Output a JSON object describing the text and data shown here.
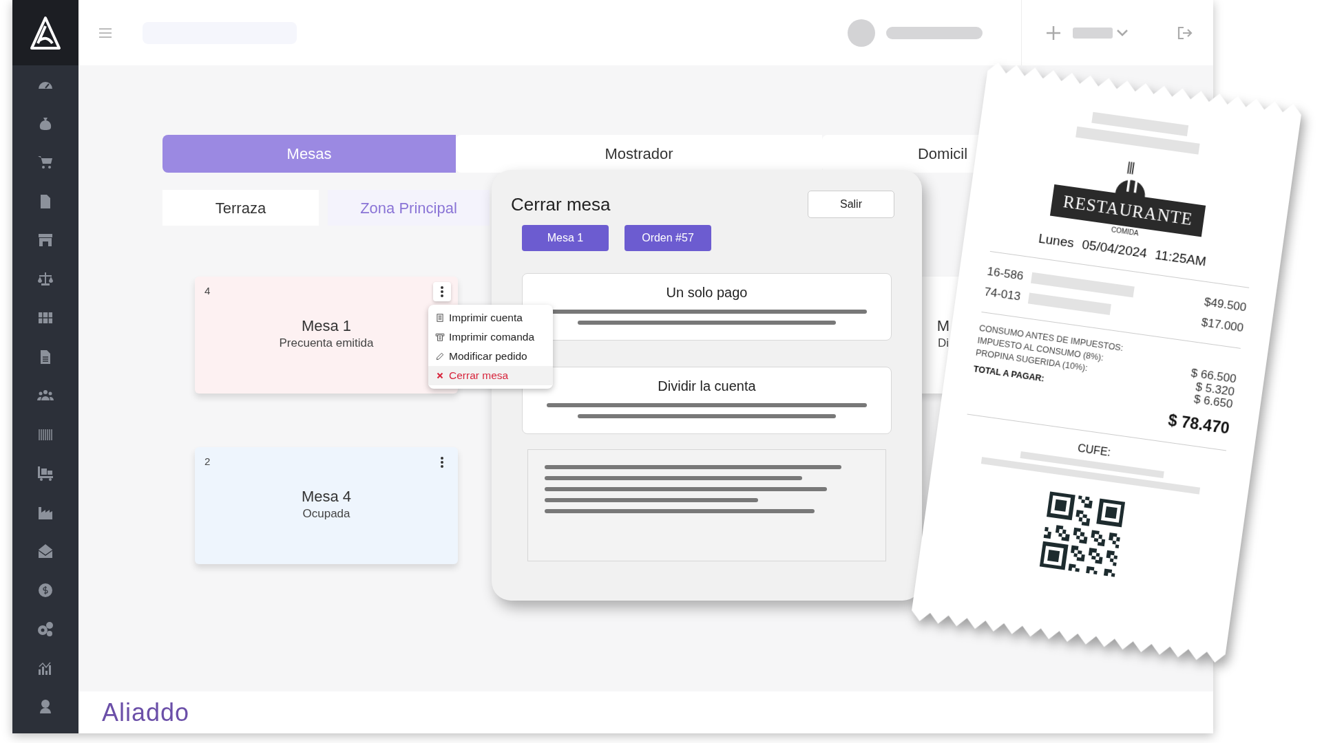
{
  "tabs": [
    {
      "label": "Mesas",
      "selected": true
    },
    {
      "label": "Mostrador",
      "selected": false
    },
    {
      "label": "Domicil",
      "selected": false
    }
  ],
  "zones": [
    {
      "label": "Terraza",
      "selected": false
    },
    {
      "label": "Zona Principal",
      "selected": true
    }
  ],
  "table_rows": [
    [
      {
        "number": "4",
        "name": "Mesa 1",
        "status": "Precuenta emitida",
        "color": "#fdf1f2",
        "menu_open": true
      },
      {
        "name": "M",
        "status": "Di",
        "color": "#ffffff"
      }
    ],
    [
      {
        "number": "2",
        "name": "Mesa 4",
        "status": "Ocupada",
        "color": "#eef5fd",
        "menu_open": false
      }
    ]
  ],
  "table_menu": [
    {
      "kind": "bill",
      "label": "Imprimir cuenta",
      "selected": false
    },
    {
      "kind": "order",
      "label": "Imprimir comanda",
      "selected": false
    },
    {
      "kind": "edit",
      "label": "Modificar pedido",
      "selected": false
    },
    {
      "kind": "close",
      "label": "Cerrar mesa",
      "selected": true
    }
  ],
  "modal": {
    "title": "Cerrar mesa",
    "exit_button": "Salir",
    "chips": [
      "Mesa 1",
      "Orden #57"
    ],
    "options": [
      {
        "label": "Un solo pago"
      },
      {
        "label": "Dividir la cuenta"
      }
    ]
  },
  "receipt": {
    "logo_name": "RESTAURANTE",
    "logo_tagline": "COMIDA",
    "date_parts": [
      "Lunes",
      "05/04/2024",
      "11:25AM"
    ],
    "items": [
      {
        "code": "16-586",
        "price": "$49.500"
      },
      {
        "code": "74-013",
        "price": "$17.000"
      }
    ],
    "summary_labels": [
      "CONSUMO ANTES DE IMPUESTOS:",
      "IMPUESTO AL CONSUMO (8%):",
      "PROPINA SUGERIDA (10%):"
    ],
    "summary_values": [
      "$ 66.500",
      "$ 5.320",
      "$ 6.650"
    ],
    "total_label": "TOTAL A PAGAR:",
    "total": "$ 78.470",
    "cufe_label": "CUFE:"
  },
  "footer": {
    "brand": "Aliaddo"
  }
}
